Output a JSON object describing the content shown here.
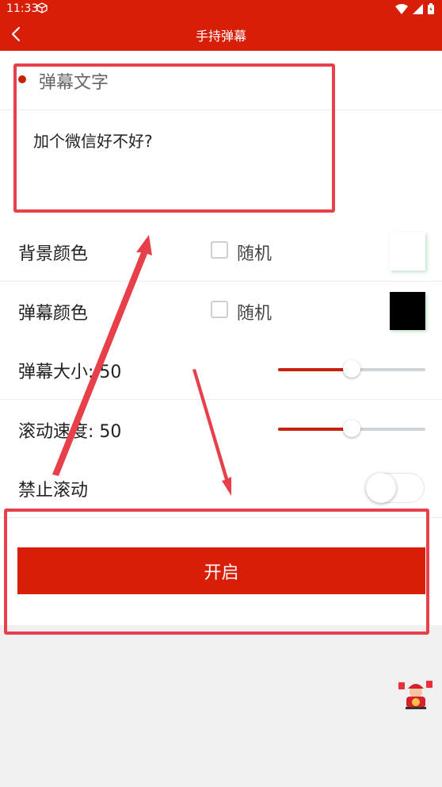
{
  "status_bar": {
    "time": "11:33"
  },
  "app_bar": {
    "title": "手持弹幕"
  },
  "danmaku_text": {
    "section_label": "弹幕文字",
    "value": "加个微信好不好?"
  },
  "background_color": {
    "label": "背景颜色",
    "random_label": "随机",
    "random_checked": false,
    "color": "#ffffff"
  },
  "danmaku_color": {
    "label": "弹幕颜色",
    "random_label": "随机",
    "random_checked": false,
    "color": "#000000"
  },
  "danmaku_size": {
    "label": "弹幕大小: 50",
    "value": 50,
    "max": 100
  },
  "scroll_speed": {
    "label": "滚动速度: 50",
    "value": 50,
    "max": 100
  },
  "disable_scroll": {
    "label": "禁止滚动",
    "enabled": false
  },
  "start_button": {
    "label": "开启"
  },
  "colors": {
    "accent": "#d81e06",
    "annotation": "#e8404a"
  }
}
